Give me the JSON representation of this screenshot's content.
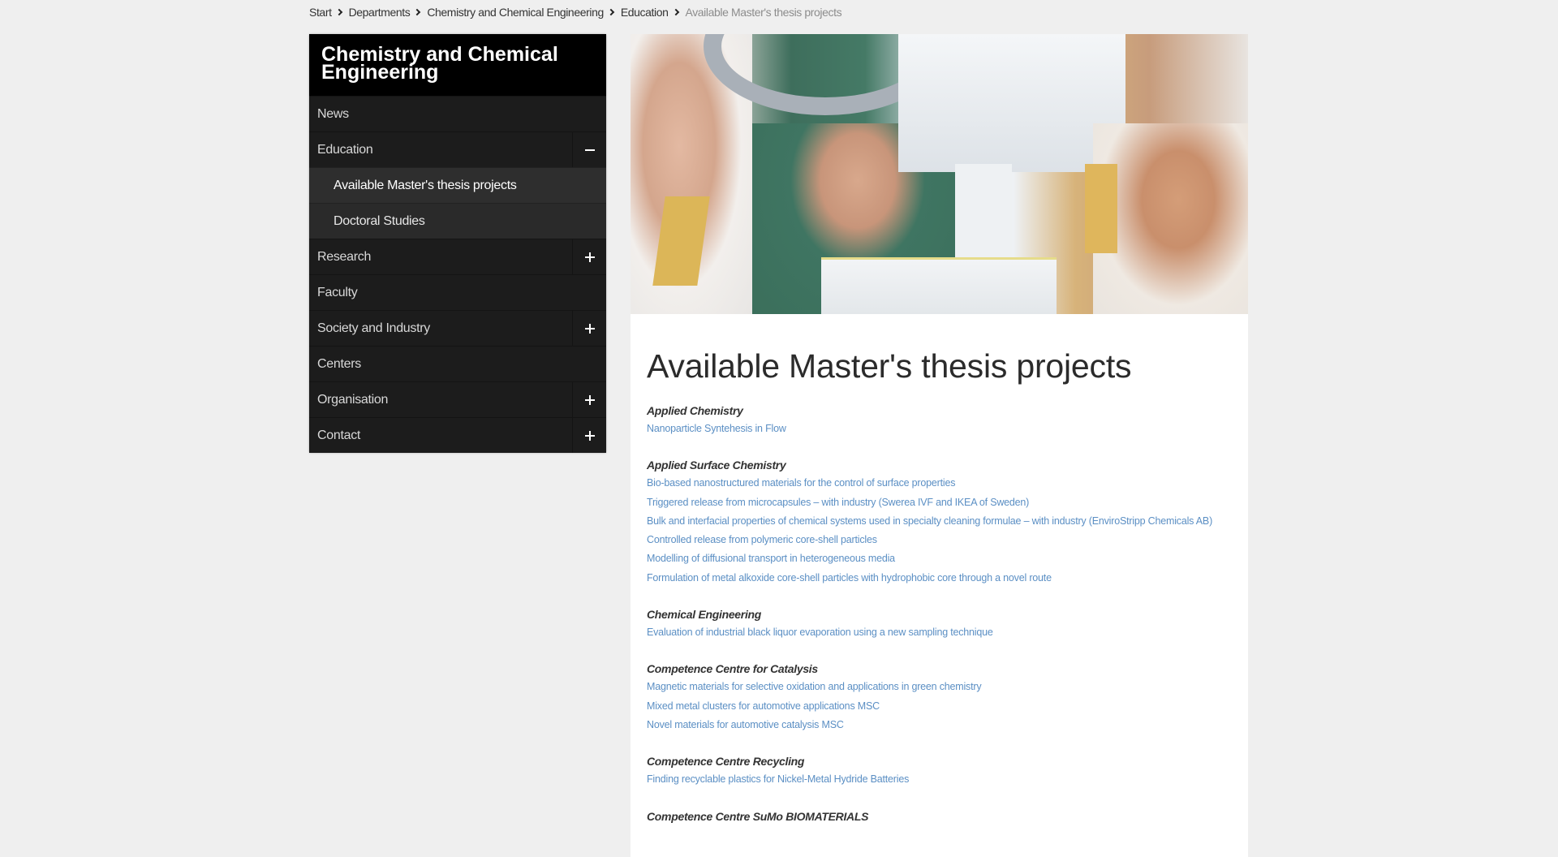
{
  "breadcrumb": {
    "items": [
      "Start",
      "Departments",
      "Chemistry and Chemical Engineering",
      "Education"
    ],
    "current": "Available Master's thesis projects",
    "separator_icon": "chevron-right-icon"
  },
  "sidebar": {
    "title": "Chemistry and Chemical Engineering",
    "items": [
      {
        "label": "News",
        "toggle": null
      },
      {
        "label": "Education",
        "toggle": "minus-icon"
      },
      {
        "label": "Available Master's thesis projects",
        "sub": true,
        "active": true
      },
      {
        "label": "Doctoral Studies",
        "sub": true
      },
      {
        "label": "Research",
        "toggle": "plus-icon"
      },
      {
        "label": "Faculty",
        "toggle": null
      },
      {
        "label": "Society and Industry",
        "toggle": "plus-icon"
      },
      {
        "label": "Centers",
        "toggle": null
      },
      {
        "label": "Organisation",
        "toggle": "plus-icon"
      },
      {
        "label": "Contact",
        "toggle": "plus-icon"
      }
    ]
  },
  "content": {
    "hero_alt": "Three researchers in lab coats and hairnets looking closely at laboratory equipment",
    "title": "Available Master's thesis projects",
    "sections": [
      {
        "title": "Applied Chemistry",
        "projects": [
          "Nanoparticle Syntehesis in Flow"
        ]
      },
      {
        "title": "Applied Surface Chemistry",
        "projects": [
          "Bio-based nanostructured materials for the control of surface properties",
          "Triggered release from microcapsules – with industry (Swerea IVF and IKEA of Sweden)",
          "Bulk and interfacial properties of chemical systems used in specialty cleaning formulae – with industry (EnviroStripp Chemicals AB)",
          "Controlled release from polymeric core-shell particles",
          "Modelling of diffusional transport in heterogeneous media",
          "Formulation of metal alkoxide core-shell particles with hydrophobic core through a novel route"
        ]
      },
      {
        "title": "Chemical Engineering",
        "projects": [
          "Evaluation of industrial black liquor evaporation using a new sampling technique"
        ]
      },
      {
        "title": "Competence Centre for Catalysis",
        "projects": [
          "Magnetic materials for selective oxidation and applications in green chemistry",
          "Mixed metal clusters for automotive applications MSC",
          "Novel materials for automotive catalysis MSC"
        ]
      },
      {
        "title": "Competence Centre Recycling",
        "projects": [
          "Finding recyclable plastics for Nickel-Metal Hydride Batteries"
        ]
      },
      {
        "title": "Competence Centre SuMo BIOMATERIALS",
        "projects": []
      }
    ]
  },
  "colors": {
    "page_bg": "#efefef",
    "sidebar_bg": "#1c1c1c",
    "sidebar_header_bg": "#000000",
    "sub_item_bg": "#2a2a2a",
    "link": "#5b8fc4",
    "breadcrumb_current": "#8c8c8c"
  }
}
